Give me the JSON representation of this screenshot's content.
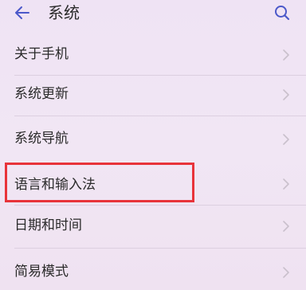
{
  "header": {
    "title": "系统",
    "back_icon": "back-arrow-icon",
    "search_icon": "search-icon"
  },
  "menu_items": [
    {
      "label": "关于手机"
    },
    {
      "label": "系统更新"
    },
    {
      "label": "系统导航"
    },
    {
      "label": "语言和输入法"
    },
    {
      "label": "日期和时间"
    },
    {
      "label": "简易模式"
    }
  ],
  "colors": {
    "background": "#f0e5f3",
    "text": "#2b2b2b",
    "accent_icon": "#4b58c9",
    "highlight_border": "#e8333a",
    "chevron": "#c9c0cc"
  }
}
